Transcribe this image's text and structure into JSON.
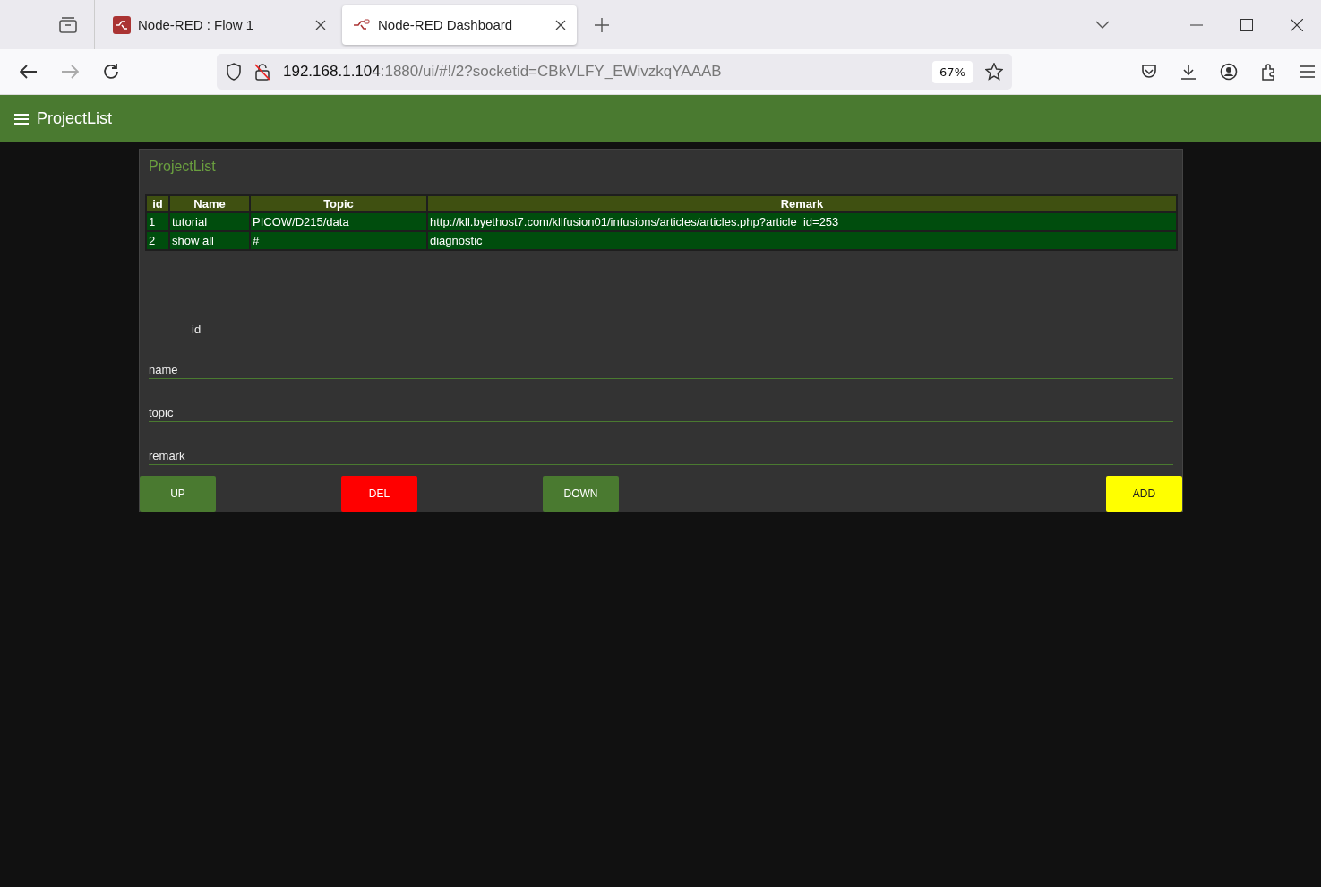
{
  "browser": {
    "tabs": [
      {
        "title": "Node-RED : Flow 1",
        "selected": false
      },
      {
        "title": "Node-RED Dashboard",
        "selected": true
      }
    ],
    "address": {
      "host": "192.168.1.104",
      "path": ":1880/ui/#!/2?socketid=CBkVLFY_EWivzkqYAAAB"
    },
    "zoom": "67%"
  },
  "header": {
    "title": "ProjectList"
  },
  "card": {
    "title": "ProjectList",
    "table": {
      "columns": [
        "id",
        "Name",
        "Topic",
        "Remark"
      ],
      "rows": [
        [
          "1",
          "tutorial",
          "PICOW/D215/data",
          "http://kll.byethost7.com/kllfusion01/infusions/articles/articles.php?article_id=253"
        ],
        [
          "2",
          "show all",
          "#",
          "diagnostic"
        ]
      ]
    },
    "id_label": "id",
    "fields": [
      {
        "placeholder": "name"
      },
      {
        "placeholder": "topic"
      },
      {
        "placeholder": "remark"
      }
    ],
    "buttons": [
      {
        "label": "UP",
        "color": "#4a7a30"
      },
      {
        "label": "DEL",
        "color": "#ff0000"
      },
      {
        "label": "DOWN",
        "color": "#4a7a30"
      },
      {
        "label": "ADD",
        "color": "#ffff00"
      }
    ]
  }
}
